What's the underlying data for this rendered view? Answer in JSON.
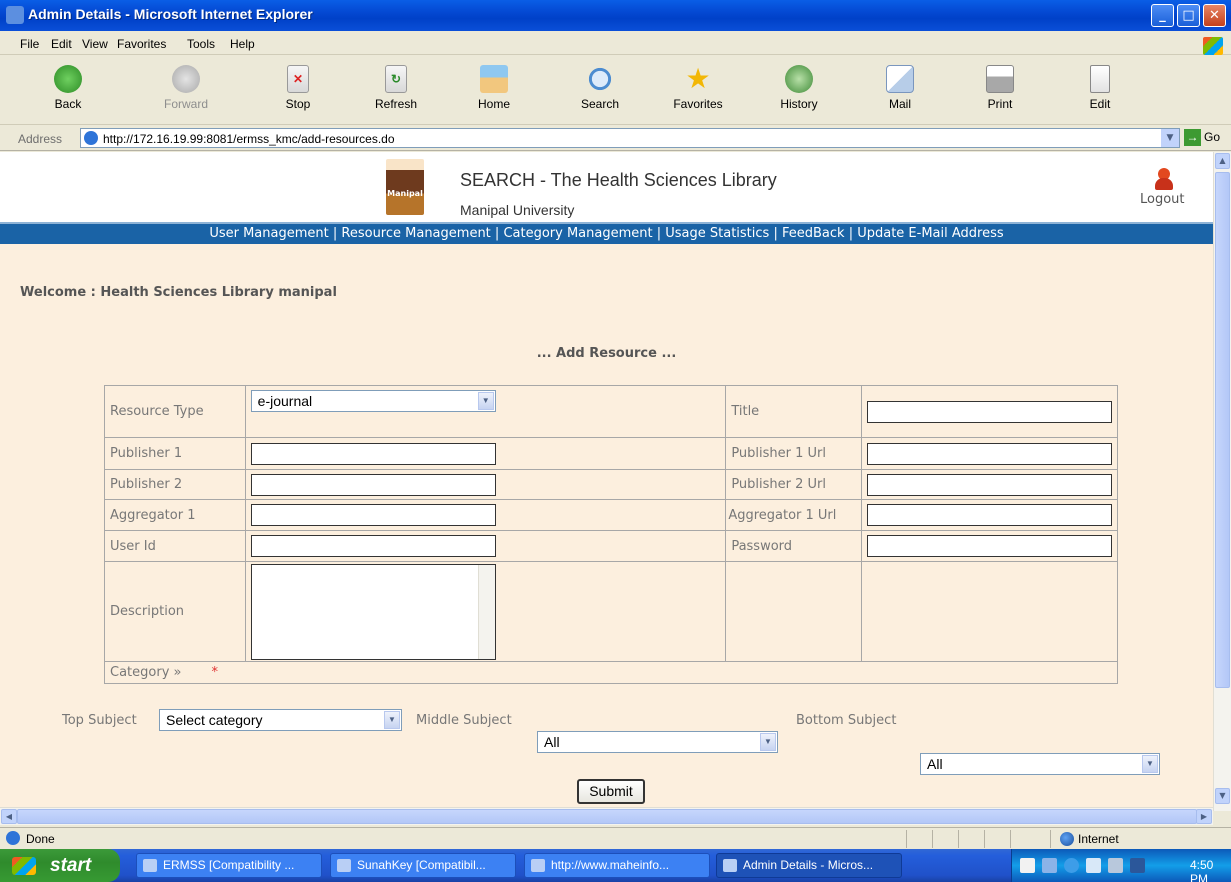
{
  "window": {
    "title": "Admin Details - Microsoft Internet Explorer"
  },
  "menu": [
    "File",
    "Edit",
    "View",
    "Favorites",
    "Tools",
    "Help"
  ],
  "toolbar": [
    {
      "label": "Back",
      "icon": "back-arrow-icon",
      "enabled": true
    },
    {
      "label": "Forward",
      "icon": "forward-arrow-icon",
      "enabled": false
    },
    {
      "label": "Stop",
      "icon": "stop-icon",
      "enabled": true
    },
    {
      "label": "Refresh",
      "icon": "refresh-icon",
      "enabled": true
    },
    {
      "label": "Home",
      "icon": "home-icon",
      "enabled": true
    },
    {
      "label": "Search",
      "icon": "search-icon",
      "enabled": true
    },
    {
      "label": "Favorites",
      "icon": "star-icon",
      "enabled": true
    },
    {
      "label": "History",
      "icon": "history-icon",
      "enabled": true
    },
    {
      "label": "Mail",
      "icon": "mail-icon",
      "enabled": true
    },
    {
      "label": "Print",
      "icon": "print-icon",
      "enabled": true
    },
    {
      "label": "Edit",
      "icon": "edit-icon",
      "enabled": true
    }
  ],
  "address": {
    "label": "Address",
    "url": "http://172.16.19.99:8081/ermss_kmc/add-resources.do",
    "go": "Go"
  },
  "site": {
    "logo_text": "Manipal",
    "title": "SEARCH - The Health Sciences Library",
    "subtitle": "Manipal University",
    "logout": "Logout"
  },
  "nav": [
    "User Management",
    "Resource Management",
    "Category Management",
    "Usage Statistics",
    "FeedBack",
    "Update E-Mail Address"
  ],
  "nav_separator": " | ",
  "welcome": "Welcome :  Health Sciences Library manipal",
  "form": {
    "heading": "... Add Resource ...",
    "resource_type_label": "Resource Type",
    "resource_type_value": "e-journal",
    "title_label": "Title",
    "publisher1_label": "Publisher 1",
    "publisher1_url_label": "Publisher 1 Url",
    "publisher2_label": "Publisher 2",
    "publisher2_url_label": "Publisher 2 Url",
    "aggregator1_label": "Aggregator 1",
    "aggregator1_url_label": "Aggregator 1 Url",
    "userid_label": "User Id",
    "password_label": "Password",
    "description_label": "Description",
    "category_label": "Category »",
    "required_mark": "*",
    "top_subject_label": "Top Subject",
    "top_subject_value": "Select category",
    "middle_subject_label": "Middle Subject",
    "middle_subject_value": "All",
    "bottom_subject_label": "Bottom Subject",
    "bottom_subject_value": "All",
    "submit": "Submit"
  },
  "status": {
    "text": "Done",
    "zone": "Internet"
  },
  "taskbar": {
    "start": "start",
    "tasks": [
      {
        "label": "ERMSS [Compatibility ...",
        "active": false
      },
      {
        "label": "SunahKey [Compatibil...",
        "active": false
      },
      {
        "label": "http://www.maheinfo...",
        "active": false
      },
      {
        "label": "Admin Details - Micros...",
        "active": true
      }
    ],
    "clock": "4:50 PM"
  },
  "colors": {
    "nav_bar": "#1A63A6",
    "page_bg": "#FCEFDE",
    "title_bar": "#0A5EE6",
    "taskbar": "#245EDB",
    "start_button": "#3C9A3A"
  }
}
